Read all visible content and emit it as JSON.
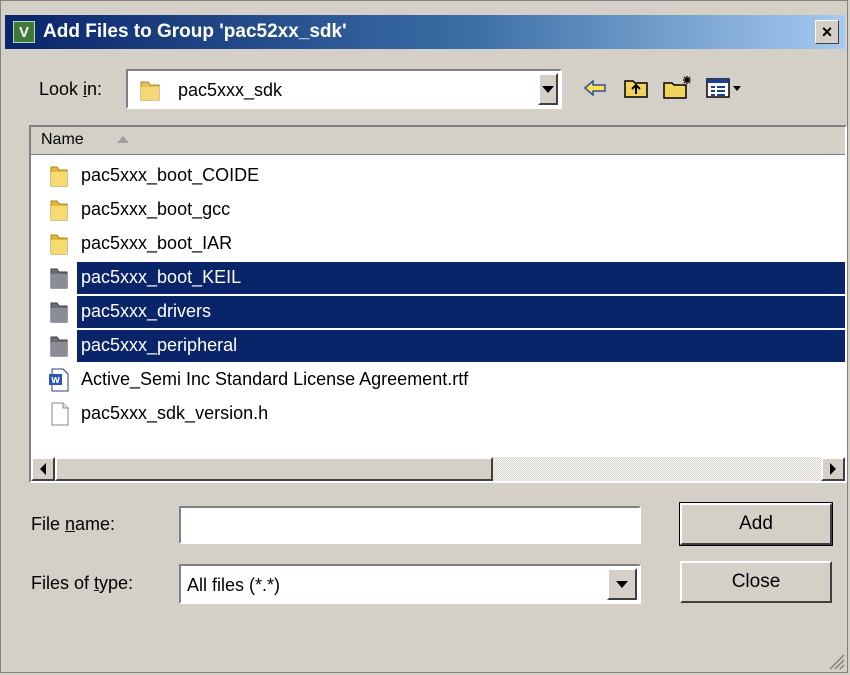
{
  "window": {
    "title": "Add Files to Group 'pac52xx_sdk'",
    "title_icon": "V",
    "close_glyph": "×"
  },
  "toolbar": {
    "look_in_pre": "Look ",
    "look_in_key": "i",
    "look_in_post": "n:",
    "look_in_value": "pac5xxx_sdk",
    "icons": [
      "back-arrow-icon",
      "up-folder-icon",
      "new-folder-icon",
      "view-menu-icon"
    ]
  },
  "filelist": {
    "column_header": "Name",
    "items": [
      {
        "name": "pac5xxx_boot_COIDE",
        "icon": "folder-icon",
        "selected": false
      },
      {
        "name": "pac5xxx_boot_gcc",
        "icon": "folder-icon",
        "selected": false
      },
      {
        "name": "pac5xxx_boot_IAR",
        "icon": "folder-icon",
        "selected": false
      },
      {
        "name": "pac5xxx_boot_KEIL",
        "icon": "folder-icon",
        "selected": true
      },
      {
        "name": "pac5xxx_drivers",
        "icon": "folder-icon",
        "selected": true
      },
      {
        "name": "pac5xxx_peripheral",
        "icon": "folder-icon",
        "selected": true
      },
      {
        "name": "Active_Semi Inc Standard License Agreement.rtf",
        "icon": "word-document-icon",
        "selected": false
      },
      {
        "name": "pac5xxx_sdk_version.h",
        "icon": "text-file-icon",
        "selected": false
      }
    ]
  },
  "form": {
    "file_name_pre": "File ",
    "file_name_key": "n",
    "file_name_post": "ame:",
    "file_name_value": "",
    "files_of_type_pre": "Files of ",
    "files_of_type_key": "t",
    "files_of_type_post": "ype:",
    "files_of_type_value": "All files (*.*)"
  },
  "buttons": {
    "add": "Add",
    "close": "Close"
  },
  "colors": {
    "title_start": "#0a246a",
    "title_end": "#a6caf0",
    "selection": "#0a246a",
    "face": "#d4d0c8"
  }
}
